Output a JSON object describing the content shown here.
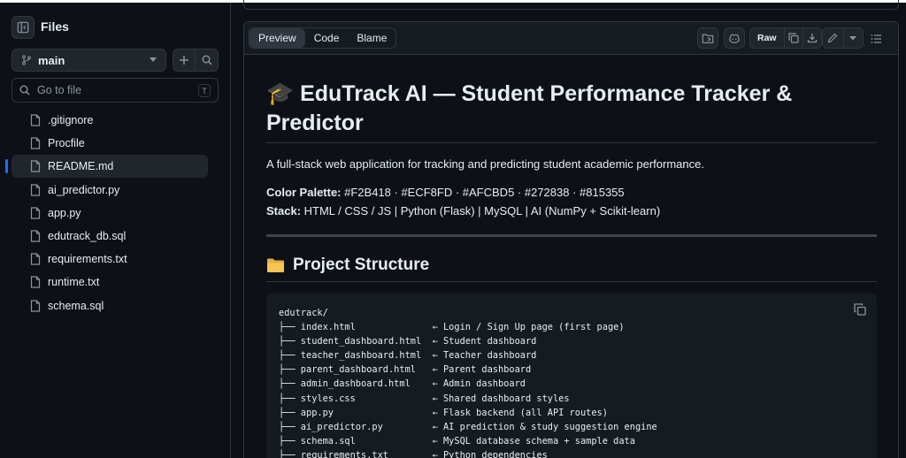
{
  "sidebar": {
    "title": "Files",
    "branch": "main",
    "goto_placeholder": "Go to file",
    "goto_shortcut": "T",
    "files": [
      {
        "name": ".gitignore",
        "active": false
      },
      {
        "name": "Procfile",
        "active": false
      },
      {
        "name": "README.md",
        "active": true
      },
      {
        "name": "ai_predictor.py",
        "active": false
      },
      {
        "name": "app.py",
        "active": false
      },
      {
        "name": "edutrack_db.sql",
        "active": false
      },
      {
        "name": "requirements.txt",
        "active": false
      },
      {
        "name": "runtime.txt",
        "active": false
      },
      {
        "name": "schema.sql",
        "active": false
      }
    ]
  },
  "file_header": {
    "tabs": [
      "Preview",
      "Code",
      "Blame"
    ],
    "active_tab": "Preview",
    "raw_label": "Raw"
  },
  "readme": {
    "title_emoji": "🎓",
    "title": "EduTrack AI — Student Performance Tracker & Predictor",
    "description": "A full-stack web application for tracking and predicting student academic performance.",
    "palette_label": "Color Palette:",
    "palette_value": " #F2B418 · #ECF8FD · #AFCBD5 · #272838 · #815355",
    "stack_label": "Stack:",
    "stack_value": " HTML / CSS / JS | Python (Flask) | MySQL | AI (NumPy + Scikit-learn)",
    "section_title": "Project Structure",
    "code_lines": [
      "edutrack/",
      "├── index.html              ← Login / Sign Up page (first page)",
      "├── student_dashboard.html  ← Student dashboard",
      "├── teacher_dashboard.html  ← Teacher dashboard",
      "├── parent_dashboard.html   ← Parent dashboard",
      "├── admin_dashboard.html    ← Admin dashboard",
      "├── styles.css              ← Shared dashboard styles",
      "├── app.py                  ← Flask backend (all API routes)",
      "├── ai_predictor.py         ← AI prediction & study suggestion engine",
      "├── schema.sql              ← MySQL database schema + sample data",
      "├── requirements.txt        ← Python dependencies"
    ]
  },
  "colors": {
    "background": "#0d1117",
    "panel": "#161b22",
    "border": "#30363d",
    "text": "#e6edf3",
    "muted": "#8b949e",
    "accent": "#1f6feb",
    "folder": "#e3b341"
  }
}
